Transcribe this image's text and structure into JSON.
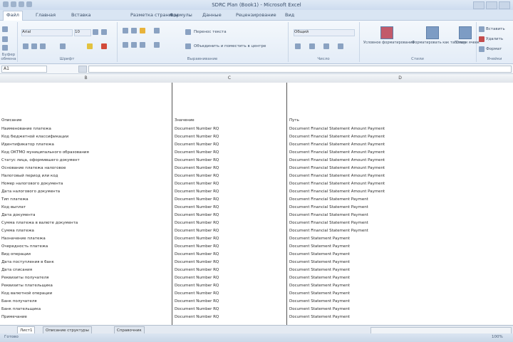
{
  "window": {
    "title": "SDRC Plan (Book1) - Microsoft Excel"
  },
  "ribbon_tabs": [
    "Файл",
    "Главная",
    "Вставка",
    "Разметка страницы",
    "Формулы",
    "Данные",
    "Рецензирование",
    "Вид"
  ],
  "ribbon": {
    "font_name": "Arial",
    "font_size": "10",
    "wrap_text": "Перенос текста",
    "merge_center": "Объединить и поместить в центре",
    "number_format": "Общий",
    "cond_format": "Условное форматирование",
    "format_table": "Форматировать как таблицу",
    "cell_styles": "Стили ячеек",
    "insert": "Вставить",
    "delete": "Удалить",
    "format": "Формат",
    "groups": [
      "Буфер обмена",
      "Шрифт",
      "Выравнивание",
      "Число",
      "Стили",
      "Ячейки"
    ]
  },
  "formula_bar": {
    "name_box": "A1",
    "fx": "fx",
    "formula": ""
  },
  "columns": [
    "B",
    "C",
    "D"
  ],
  "header_row": {
    "b": "Описание",
    "c": "Значение",
    "d": "Путь"
  },
  "rows": [
    {
      "b": "Наименование платежа",
      "c": "Document Number RQ",
      "d": "Document Financial Statement Amount Payment"
    },
    {
      "b": "Код бюджетной классификации",
      "c": "Document Number RQ",
      "d": "Document Financial Statement Amount Payment"
    },
    {
      "b": "Идентификатор платежа",
      "c": "Document Number RQ",
      "d": "Document Financial Statement Amount Payment"
    },
    {
      "b": "Код ОКТМО муниципального образования",
      "c": "Document Number RQ",
      "d": "Document Financial Statement Amount Payment"
    },
    {
      "b": "Статус лица, оформившего документ",
      "c": "Document Number RQ",
      "d": "Document Financial Statement Amount Payment"
    },
    {
      "b": "Основание платежа налоговое",
      "c": "Document Number RQ",
      "d": "Document Financial Statement Amount Payment"
    },
    {
      "b": "Налоговый период или код",
      "c": "Document Number RQ",
      "d": "Document Financial Statement Amount Payment"
    },
    {
      "b": "Номер налогового документа",
      "c": "Document Number RQ",
      "d": "Document Financial Statement Amount Payment"
    },
    {
      "b": "Дата налогового документа",
      "c": "Document Number RQ",
      "d": "Document Financial Statement Amount Payment"
    },
    {
      "b": "Тип платежа",
      "c": "Document Number RQ",
      "d": "Document Financial Statement Payment"
    },
    {
      "b": "Код выплат",
      "c": "Document Number RQ",
      "d": "Document Financial Statement Payment"
    },
    {
      "b": "Дата документа",
      "c": "Document Number RQ",
      "d": "Document Financial Statement Payment"
    },
    {
      "b": "Сумма платежа в валюте документа",
      "c": "Document Number RQ",
      "d": "Document Financial Statement Payment"
    },
    {
      "b": "Сумма платежа",
      "c": "Document Number RQ",
      "d": "Document Financial Statement Payment"
    },
    {
      "b": "Назначение платежа",
      "c": "Document Number RQ",
      "d": "Document Statement Payment"
    },
    {
      "b": "Очередность платежа",
      "c": "Document Number RQ",
      "d": "Document Statement Payment"
    },
    {
      "b": "Вид операции",
      "c": "Document Number RQ",
      "d": "Document Statement Payment"
    },
    {
      "b": "Дата поступления в банк",
      "c": "Document Number RQ",
      "d": "Document Statement Payment"
    },
    {
      "b": "Дата списания",
      "c": "Document Number RQ",
      "d": "Document Statement Payment"
    },
    {
      "b": "Реквизиты получателя",
      "c": "Document Number RQ",
      "d": "Document Statement Payment"
    },
    {
      "b": "Реквизиты плательщика",
      "c": "Document Number RQ",
      "d": "Document Statement Payment"
    },
    {
      "b": "Код валютной операции",
      "c": "Document Number RQ",
      "d": "Document Statement Payment"
    },
    {
      "b": "Банк получателя",
      "c": "Document Number RQ",
      "d": "Document Statement Payment"
    },
    {
      "b": "Банк плательщика",
      "c": "Document Number RQ",
      "d": "Document Statement Payment"
    },
    {
      "b": "Примечание",
      "c": "Document Number RQ",
      "d": "Document Statement Payment"
    }
  ],
  "sheet_tabs": [
    "Лист1",
    "Описание структуры",
    "Справочник"
  ],
  "status": {
    "ready": "Готово",
    "zoom": "100%"
  }
}
